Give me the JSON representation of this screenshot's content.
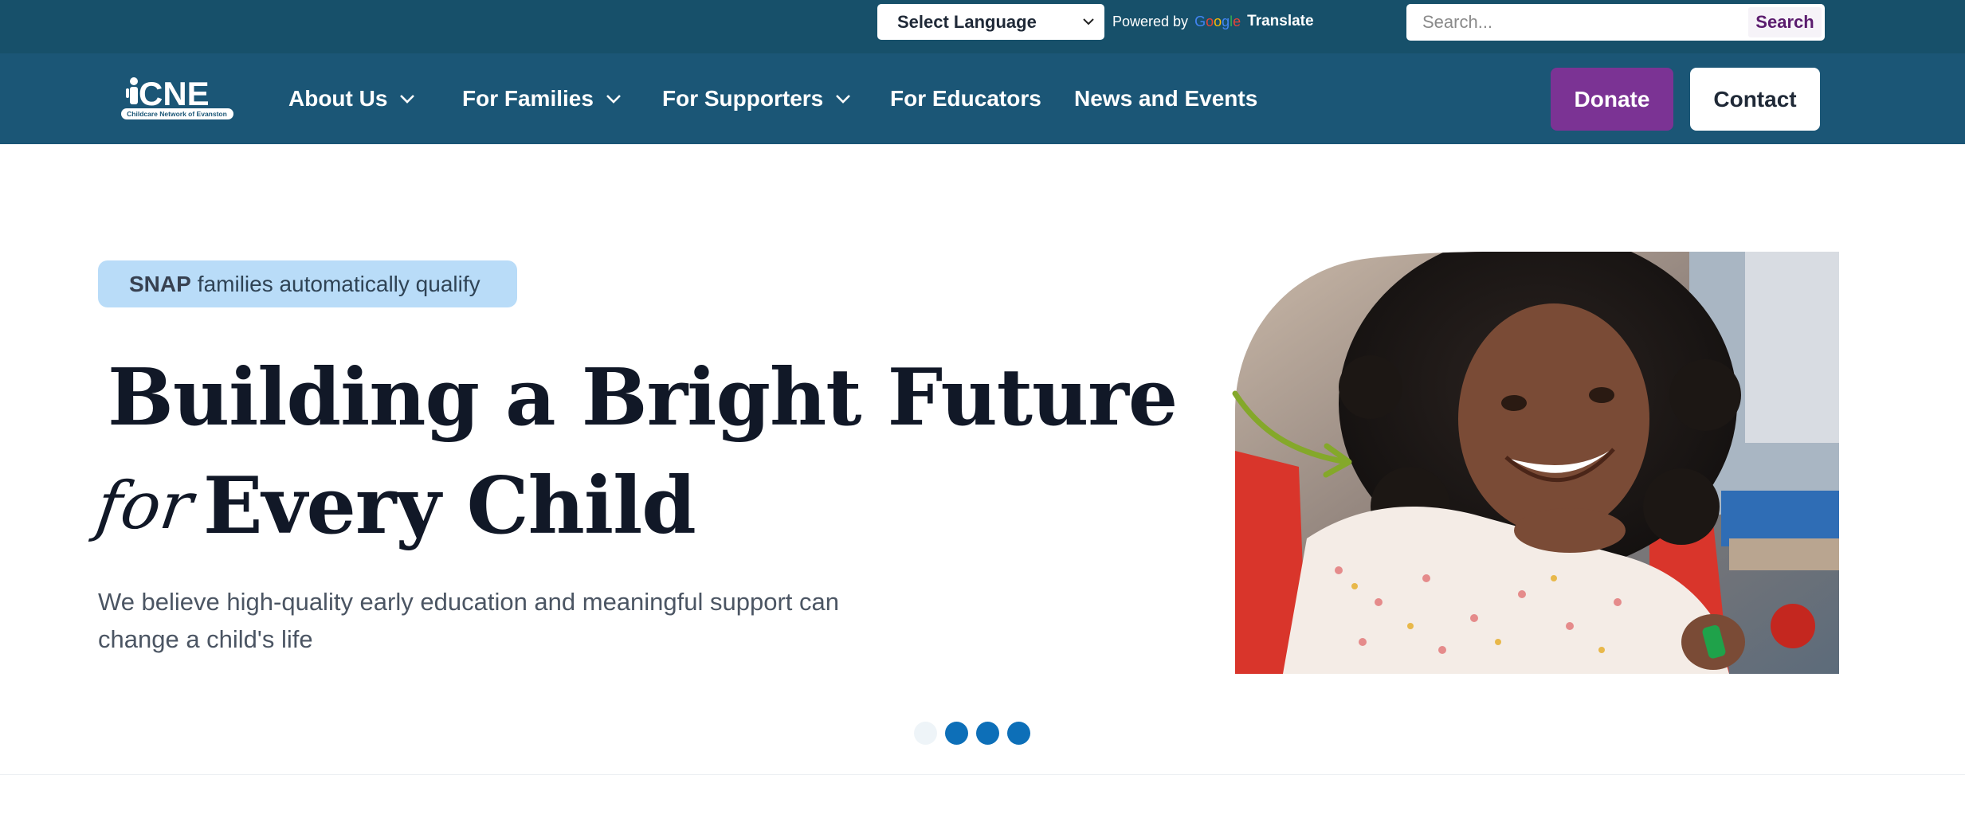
{
  "topbar": {
    "language_select": "Select Language",
    "powered_by": "Powered by",
    "google": "Google",
    "translate": "Translate",
    "search_placeholder": "Search...",
    "search_button": "Search"
  },
  "nav": {
    "logo_text": "CNE",
    "logo_subtitle": "Childcare Network of Evanston",
    "items": [
      {
        "label": "About Us"
      },
      {
        "label": "For Families"
      },
      {
        "label": "For Supporters"
      },
      {
        "label": "For Educators"
      },
      {
        "label": "News and Events"
      }
    ],
    "donate": "Donate",
    "contact": "Contact"
  },
  "hero": {
    "badge_bold": "SNAP",
    "badge_text": "families automatically qualify",
    "title_line1": "Building a Bright Future",
    "title_for": "for",
    "title_line2": "Every Child",
    "subtitle": "We believe high-quality early education and meaningful support can change a child's life"
  },
  "carousel": {
    "slide_count": 4,
    "active_index": 0
  },
  "colors": {
    "topbar": "#17506a",
    "navbar": "#1b5676",
    "donate": "#7b3394",
    "badge": "#b9dcf8",
    "dot_active": "#0d6fb8",
    "arrow": "#84a82a"
  }
}
